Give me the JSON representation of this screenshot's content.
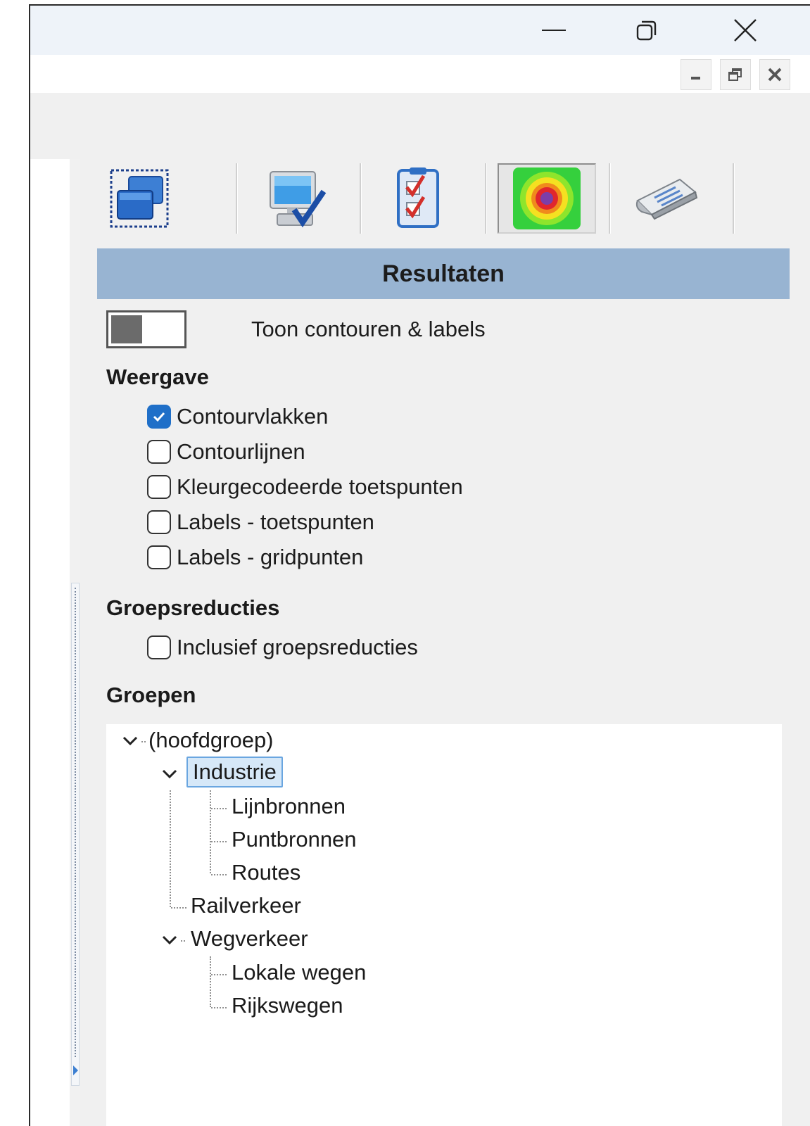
{
  "window": {
    "caption_buttons": [
      "minimize-icon",
      "restore-icon",
      "close-icon"
    ],
    "mdi_buttons": [
      "minimize-icon",
      "restore-icon",
      "close-icon"
    ]
  },
  "toolbar": {
    "tabs": [
      {
        "icon": "windows-icon"
      },
      {
        "icon": "monitor-check-icon"
      },
      {
        "icon": "checklist-icon"
      },
      {
        "icon": "contour-target-icon",
        "selected": true
      },
      {
        "icon": "newspaper-icon"
      }
    ]
  },
  "panel": {
    "title": "Resultaten",
    "toggle_label": "Toon contouren & labels",
    "weergave": {
      "heading": "Weergave",
      "options": [
        {
          "label": "Contourvlakken",
          "checked": true
        },
        {
          "label": "Contourlijnen",
          "checked": false
        },
        {
          "label": "Kleurgecodeerde toetspunten",
          "checked": false
        },
        {
          "label": "Labels - toetspunten",
          "checked": false
        },
        {
          "label": "Labels - gridpunten",
          "checked": false
        }
      ]
    },
    "groepsreducties": {
      "heading": "Groepsreducties",
      "options": [
        {
          "label": "Inclusief groepsreducties",
          "checked": false
        }
      ]
    },
    "groepen": {
      "heading": "Groepen",
      "tree": {
        "root": "(hoofdgroep)",
        "industrie": "Industrie",
        "industrie_children": [
          "Lijnbronnen",
          "Puntbronnen",
          "Routes"
        ],
        "railverkeer": "Railverkeer",
        "wegverkeer": "Wegverkeer",
        "wegverkeer_children": [
          "Lokale wegen",
          "Rijkswegen"
        ]
      }
    }
  },
  "colors": {
    "header_bg": "#98b4d2",
    "checkbox_checked": "#1f6fc8",
    "selection": "#d6e8f8"
  }
}
